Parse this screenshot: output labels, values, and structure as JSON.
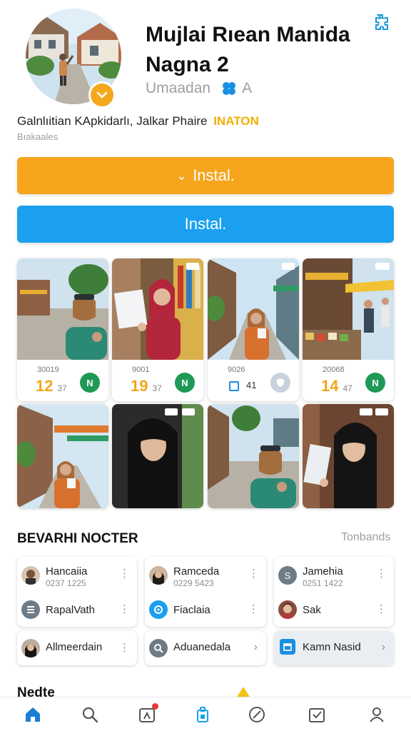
{
  "app": {
    "title": "Mujlai Rıean Manida Nagna 2",
    "publisher": "Umaadan",
    "rating_letter": "A",
    "meta_text": "Galnlıitian KApkidarlı, Jalkar Phaire",
    "meta_highlight": "INATON",
    "meta_sub": "Bıakaales",
    "accent_orange": "#f7a51c",
    "accent_blue": "#1aa0ee"
  },
  "buttons": {
    "install_primary": "Instal.",
    "install_secondary": "Instal."
  },
  "gallery": {
    "cards": [
      {
        "small": "30019",
        "big": "12",
        "minor": "37",
        "action": "N"
      },
      {
        "small": "9001",
        "big": "19",
        "minor": "37",
        "action": "N"
      },
      {
        "small": "9026",
        "count": "41"
      },
      {
        "small": "20068",
        "big": "14",
        "minor": "47",
        "action": "N"
      }
    ]
  },
  "section": {
    "title": "BEVARHI NOCTER",
    "link": "Tonbands"
  },
  "contacts": [
    {
      "name": "Hancaiia",
      "phone": "0237 1225"
    },
    {
      "name": "Ramceda",
      "phone": "0229 5423"
    },
    {
      "name": "Jamehia",
      "phone": "0251 1422"
    },
    {
      "name": "RapalVath"
    },
    {
      "name": "Fiaclaia"
    },
    {
      "name": "Sak"
    },
    {
      "name": "Allmeerdain"
    },
    {
      "name": "Aduanedala"
    },
    {
      "name": "Kamn Nasid"
    }
  ],
  "peek": {
    "title": "Nedte"
  },
  "icons": {
    "settings": "gear-puzzle-icon",
    "verified": "chevron-down-icon",
    "rating": "clover-icon",
    "nav": [
      "home-icon",
      "search-icon",
      "media-icon",
      "bag-icon",
      "compass-icon",
      "downloads-icon",
      "profile-icon"
    ]
  }
}
